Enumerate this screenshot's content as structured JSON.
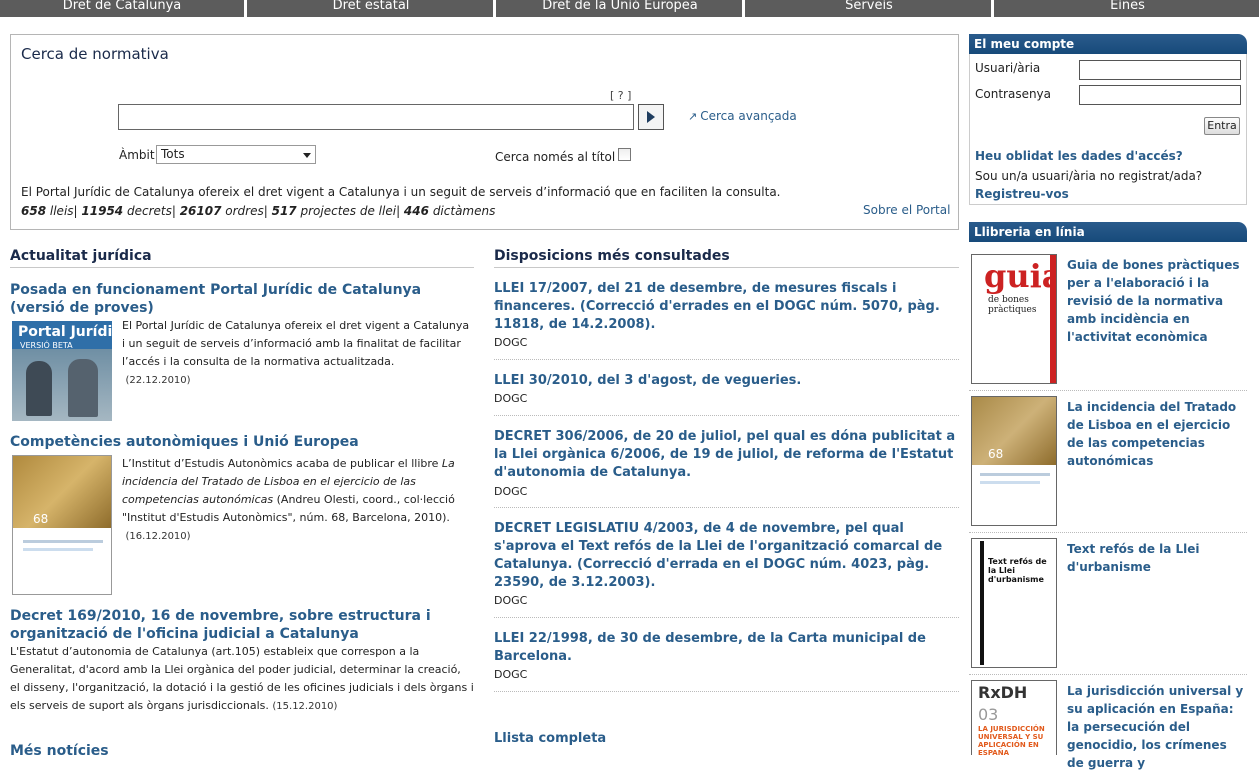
{
  "nav": {
    "tabs": [
      {
        "label": "Dret de Catalunya"
      },
      {
        "label": "Dret estatal"
      },
      {
        "label": "Dret de la Unió Europea"
      },
      {
        "label": "Serveis"
      },
      {
        "label": "Eines"
      }
    ]
  },
  "search": {
    "title": "Cerca de normativa",
    "help": "[ ? ]",
    "input_value": "",
    "advanced_label": "Cerca avançada",
    "ambit_label": "Àmbit",
    "ambit_value": "Tots",
    "title_only_label": "Cerca només al títol",
    "description": "El Portal Jurídic de Catalunya ofereix el dret vigent a Catalunya i un seguit de serveis d’informació que en faciliten la consulta.",
    "stats": {
      "lleis": "658",
      "lleis_label": "lleis",
      "decrets": "11954",
      "decrets_label": "decrets",
      "ordres": "26107",
      "ordres_label": "ordres",
      "projectes": "517",
      "projectes_label": "projectes de llei",
      "dictamens": "446",
      "dictamens_label": "dictàmens"
    },
    "about_link": "Sobre el Portal"
  },
  "news": {
    "heading": "Actualitat jurídica",
    "items": [
      {
        "title": "Posada en funcionament Portal Jurídic de Catalunya (versió de proves)",
        "body": "El Portal Jurídic de Catalunya ofereix el dret vigent a Catalunya i un seguit de serveis d’informació amb la finalitat de facilitar l’accés i la consulta de la normativa actualitzada.",
        "date": "(22.12.2010)",
        "thumb_title": "Portal Jurídic",
        "thumb_subtitle": "VERSIÓ BETA"
      },
      {
        "title": "Competències autonòmiques i Unió Europea",
        "body_pre": "L’Institut d’Estudis Autonòmics acaba de publicar el llibre ",
        "body_em": "La incidencia del Tratado de Lisboa en el ejercicio de las competencias autonómicas",
        "body_post": " (Andreu Olesti, coord., col·lecció \"Institut d'Estudis Autonòmics\", núm. 68, Barcelona, 2010).",
        "date": "(16.12.2010)",
        "thumb_number": "68"
      },
      {
        "title": "Decret 169/2010, 16 de novembre, sobre estructura i organització de l'oficina judicial a Catalunya",
        "body": "L'Estatut d’autonomia de Catalunya (art.105) estableix que correspon a la Generalitat, d'acord amb la Llei orgànica del poder judicial, determinar la creació, el disseny, l'organització, la dotació i la gestió de les oficines judicials i dels òrgans i els serveis de suport als òrgans jurisdiccionals.",
        "date": "(15.12.2010)"
      }
    ],
    "more_link": "Més notícies"
  },
  "dispositions": {
    "heading": "Disposicions més consultades",
    "items": [
      {
        "title": "LLEI 17/2007, del 21 de desembre, de mesures fiscals i financeres. (Correcció d'errades en el DOGC núm. 5070, pàg. 11818, de 14.2.2008).",
        "source": "DOGC"
      },
      {
        "title": "LLEI 30/2010, del 3 d'agost, de vegueries.",
        "source": "DOGC"
      },
      {
        "title": "DECRET 306/2006, de 20 de juliol, pel qual es dóna publicitat a la Llei orgànica 6/2006, de 19 de juliol, de reforma de l'Estatut d'autonomia de Catalunya.",
        "source": "DOGC"
      },
      {
        "title": "DECRET LEGISLATIU 4/2003, de 4 de novembre, pel qual s'aprova el Text refós de la Llei de l'organització comarcal de Catalunya. (Correcció d'errada en el DOGC núm. 4023, pàg. 23590, de 3.12.2003).",
        "source": "DOGC"
      },
      {
        "title": "LLEI 22/1998, de 30 de desembre, de la Carta municipal de Barcelona.",
        "source": "DOGC"
      }
    ],
    "full_list_link": "Llista completa"
  },
  "account": {
    "heading": "El meu compte",
    "user_label": "Usuari/ària",
    "password_label": "Contrasenya",
    "user_value": "",
    "password_value": "",
    "login_button": "Entra",
    "forgot_link": "Heu oblidat les dades d'accés?",
    "register_text": "Sou un/a usuari/ària no registrat/ada?",
    "register_link": "Registreu-vos"
  },
  "bookstore": {
    "heading": "Llibreria en línia",
    "items": [
      {
        "title": "Guia de bones pràctiques per a l'elaboració i la revisió de la normativa amb incidència en l'activitat econòmica",
        "cover_big": "guia",
        "cover_small": "de bones pràctiques"
      },
      {
        "title": "La incidencia del Tratado de Lisboa en el ejercicio de las competencias autonómicas",
        "cover_number": "68"
      },
      {
        "title": "Text refós de la Llei d'urbanisme",
        "cover_text": "Text refós de la Llei d'urbanisme"
      },
      {
        "title": "La jurisdicción universal y su aplicación en España: la persecución del genocidio, los crímenes de guerra y",
        "cover_big": "RxDH",
        "cover_number": "03",
        "cover_text": "LA JURISDICCIÓN UNIVERSAL Y SU APLICACIÓN EN ESPAÑA"
      }
    ]
  },
  "colors": {
    "nav_bg": "#5c5c5c",
    "link": "#2a5d8a",
    "side_header": "#1f4f80"
  }
}
